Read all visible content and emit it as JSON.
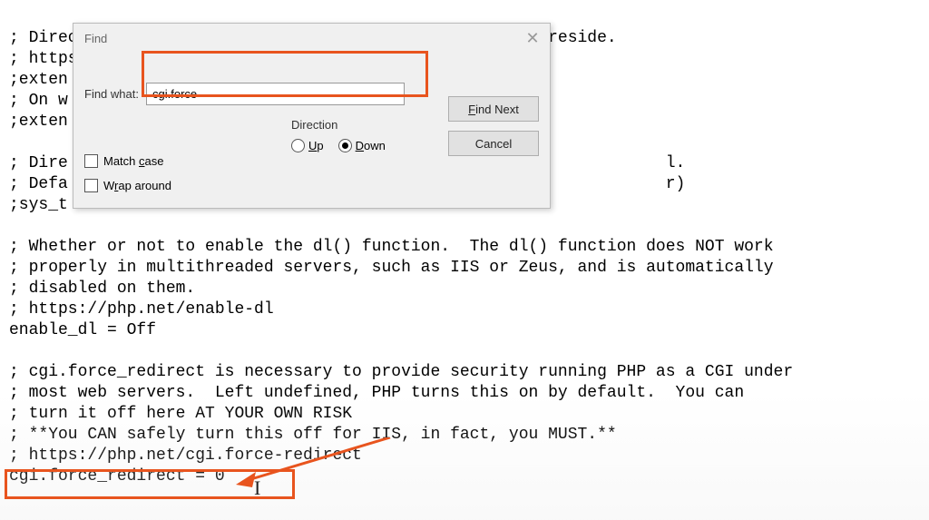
{
  "editor": {
    "lines": [
      "; Directory in which the loadable extensions (modules) reside.",
      "; https",
      ";exten",
      "; On w",
      ";exten",
      "",
      "; Dire                                                             l.",
      "; Defa                                                             r)",
      ";sys_t",
      "",
      "; Whether or not to enable the dl() function.  The dl() function does NOT work",
      "; properly in multithreaded servers, such as IIS or Zeus, and is automatically",
      "; disabled on them.",
      "; https://php.net/enable-dl",
      "enable_dl = Off",
      "",
      "; cgi.force_redirect is necessary to provide security running PHP as a CGI under",
      "; most web servers.  Left undefined, PHP turns this on by default.  You can",
      "; turn it off here AT YOUR OWN RISK",
      "; **You CAN safely turn this off for IIS, in fact, you MUST.**",
      "; https://php.net/cgi.force-redirect",
      "cgi.force_redirect = 0"
    ]
  },
  "dialog": {
    "title": "Find",
    "find_what_label": "Find what:",
    "find_what_value": "cgi.force",
    "direction_label": "Direction",
    "up_label": "Up",
    "down_label": "Down",
    "match_case_label": "Match case",
    "wrap_around_label": "Wrap around",
    "find_next_label": "Find Next",
    "cancel_label": "Cancel"
  }
}
